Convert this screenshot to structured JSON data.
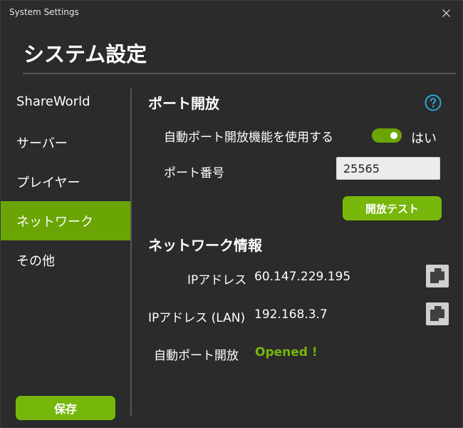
{
  "window": {
    "title": "System Settings",
    "close_icon": "close-icon"
  },
  "page": {
    "title": "システム設定"
  },
  "sidebar": {
    "items": [
      {
        "label": "ShareWorld",
        "active": false
      },
      {
        "label": "サーバー",
        "active": false
      },
      {
        "label": "プレイヤー",
        "active": false
      },
      {
        "label": "ネットワーク",
        "active": true
      },
      {
        "label": "その他",
        "active": false
      }
    ],
    "save_label": "保存"
  },
  "port_section": {
    "heading": "ポート開放",
    "help_icon": "help-icon",
    "auto_port_label": "自動ポート開放機能を使用する",
    "auto_port_enabled": true,
    "auto_port_state_text": "はい",
    "port_number_label": "ポート番号",
    "port_number_value": "25565",
    "test_button_label": "開放テスト"
  },
  "network_info": {
    "heading": "ネットワーク情報",
    "ip_label": "IPアドレス",
    "ip_value": "60.147.229.195",
    "lan_ip_label": "IPアドレス (LAN)",
    "lan_ip_value": "192.168.3.7",
    "auto_port_status_label": "自動ポート開放",
    "auto_port_status_value": "Opened !",
    "copy_icon": "copy-icon"
  },
  "colors": {
    "accent": "#77b60a",
    "active_nav": "#6aa505",
    "background": "#2b2b2b",
    "help_icon": "#2aa7d9"
  }
}
